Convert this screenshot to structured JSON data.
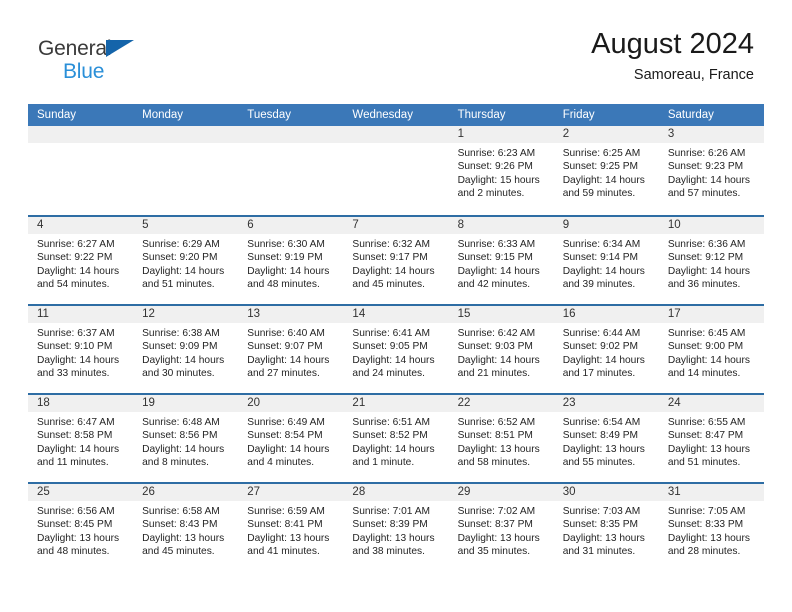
{
  "brand": {
    "name_top": "General",
    "name_bottom": "Blue",
    "triangle_color": "#1464aa",
    "top_color": "#3a3a3a",
    "bottom_color": "#2a8fd8"
  },
  "header": {
    "title": "August 2024",
    "subtitle": "Samoreau, France"
  },
  "theme": {
    "header_bg": "#3b78b8",
    "row_border": "#2e6da4",
    "day_band_bg": "#f0f0f0",
    "text": "#242424"
  },
  "weekdays": [
    "Sunday",
    "Monday",
    "Tuesday",
    "Wednesday",
    "Thursday",
    "Friday",
    "Saturday"
  ],
  "weeks": [
    [
      {
        "day": "",
        "sunrise": "",
        "sunset": "",
        "daylight": "",
        "empty": true
      },
      {
        "day": "",
        "sunrise": "",
        "sunset": "",
        "daylight": "",
        "empty": true
      },
      {
        "day": "",
        "sunrise": "",
        "sunset": "",
        "daylight": "",
        "empty": true
      },
      {
        "day": "",
        "sunrise": "",
        "sunset": "",
        "daylight": "",
        "empty": true
      },
      {
        "day": "1",
        "sunrise": "Sunrise: 6:23 AM",
        "sunset": "Sunset: 9:26 PM",
        "daylight": "Daylight: 15 hours and 2 minutes."
      },
      {
        "day": "2",
        "sunrise": "Sunrise: 6:25 AM",
        "sunset": "Sunset: 9:25 PM",
        "daylight": "Daylight: 14 hours and 59 minutes."
      },
      {
        "day": "3",
        "sunrise": "Sunrise: 6:26 AM",
        "sunset": "Sunset: 9:23 PM",
        "daylight": "Daylight: 14 hours and 57 minutes."
      }
    ],
    [
      {
        "day": "4",
        "sunrise": "Sunrise: 6:27 AM",
        "sunset": "Sunset: 9:22 PM",
        "daylight": "Daylight: 14 hours and 54 minutes."
      },
      {
        "day": "5",
        "sunrise": "Sunrise: 6:29 AM",
        "sunset": "Sunset: 9:20 PM",
        "daylight": "Daylight: 14 hours and 51 minutes."
      },
      {
        "day": "6",
        "sunrise": "Sunrise: 6:30 AM",
        "sunset": "Sunset: 9:19 PM",
        "daylight": "Daylight: 14 hours and 48 minutes."
      },
      {
        "day": "7",
        "sunrise": "Sunrise: 6:32 AM",
        "sunset": "Sunset: 9:17 PM",
        "daylight": "Daylight: 14 hours and 45 minutes."
      },
      {
        "day": "8",
        "sunrise": "Sunrise: 6:33 AM",
        "sunset": "Sunset: 9:15 PM",
        "daylight": "Daylight: 14 hours and 42 minutes."
      },
      {
        "day": "9",
        "sunrise": "Sunrise: 6:34 AM",
        "sunset": "Sunset: 9:14 PM",
        "daylight": "Daylight: 14 hours and 39 minutes."
      },
      {
        "day": "10",
        "sunrise": "Sunrise: 6:36 AM",
        "sunset": "Sunset: 9:12 PM",
        "daylight": "Daylight: 14 hours and 36 minutes."
      }
    ],
    [
      {
        "day": "11",
        "sunrise": "Sunrise: 6:37 AM",
        "sunset": "Sunset: 9:10 PM",
        "daylight": "Daylight: 14 hours and 33 minutes."
      },
      {
        "day": "12",
        "sunrise": "Sunrise: 6:38 AM",
        "sunset": "Sunset: 9:09 PM",
        "daylight": "Daylight: 14 hours and 30 minutes."
      },
      {
        "day": "13",
        "sunrise": "Sunrise: 6:40 AM",
        "sunset": "Sunset: 9:07 PM",
        "daylight": "Daylight: 14 hours and 27 minutes."
      },
      {
        "day": "14",
        "sunrise": "Sunrise: 6:41 AM",
        "sunset": "Sunset: 9:05 PM",
        "daylight": "Daylight: 14 hours and 24 minutes."
      },
      {
        "day": "15",
        "sunrise": "Sunrise: 6:42 AM",
        "sunset": "Sunset: 9:03 PM",
        "daylight": "Daylight: 14 hours and 21 minutes."
      },
      {
        "day": "16",
        "sunrise": "Sunrise: 6:44 AM",
        "sunset": "Sunset: 9:02 PM",
        "daylight": "Daylight: 14 hours and 17 minutes."
      },
      {
        "day": "17",
        "sunrise": "Sunrise: 6:45 AM",
        "sunset": "Sunset: 9:00 PM",
        "daylight": "Daylight: 14 hours and 14 minutes."
      }
    ],
    [
      {
        "day": "18",
        "sunrise": "Sunrise: 6:47 AM",
        "sunset": "Sunset: 8:58 PM",
        "daylight": "Daylight: 14 hours and 11 minutes."
      },
      {
        "day": "19",
        "sunrise": "Sunrise: 6:48 AM",
        "sunset": "Sunset: 8:56 PM",
        "daylight": "Daylight: 14 hours and 8 minutes."
      },
      {
        "day": "20",
        "sunrise": "Sunrise: 6:49 AM",
        "sunset": "Sunset: 8:54 PM",
        "daylight": "Daylight: 14 hours and 4 minutes."
      },
      {
        "day": "21",
        "sunrise": "Sunrise: 6:51 AM",
        "sunset": "Sunset: 8:52 PM",
        "daylight": "Daylight: 14 hours and 1 minute."
      },
      {
        "day": "22",
        "sunrise": "Sunrise: 6:52 AM",
        "sunset": "Sunset: 8:51 PM",
        "daylight": "Daylight: 13 hours and 58 minutes."
      },
      {
        "day": "23",
        "sunrise": "Sunrise: 6:54 AM",
        "sunset": "Sunset: 8:49 PM",
        "daylight": "Daylight: 13 hours and 55 minutes."
      },
      {
        "day": "24",
        "sunrise": "Sunrise: 6:55 AM",
        "sunset": "Sunset: 8:47 PM",
        "daylight": "Daylight: 13 hours and 51 minutes."
      }
    ],
    [
      {
        "day": "25",
        "sunrise": "Sunrise: 6:56 AM",
        "sunset": "Sunset: 8:45 PM",
        "daylight": "Daylight: 13 hours and 48 minutes."
      },
      {
        "day": "26",
        "sunrise": "Sunrise: 6:58 AM",
        "sunset": "Sunset: 8:43 PM",
        "daylight": "Daylight: 13 hours and 45 minutes."
      },
      {
        "day": "27",
        "sunrise": "Sunrise: 6:59 AM",
        "sunset": "Sunset: 8:41 PM",
        "daylight": "Daylight: 13 hours and 41 minutes."
      },
      {
        "day": "28",
        "sunrise": "Sunrise: 7:01 AM",
        "sunset": "Sunset: 8:39 PM",
        "daylight": "Daylight: 13 hours and 38 minutes."
      },
      {
        "day": "29",
        "sunrise": "Sunrise: 7:02 AM",
        "sunset": "Sunset: 8:37 PM",
        "daylight": "Daylight: 13 hours and 35 minutes."
      },
      {
        "day": "30",
        "sunrise": "Sunrise: 7:03 AM",
        "sunset": "Sunset: 8:35 PM",
        "daylight": "Daylight: 13 hours and 31 minutes."
      },
      {
        "day": "31",
        "sunrise": "Sunrise: 7:05 AM",
        "sunset": "Sunset: 8:33 PM",
        "daylight": "Daylight: 13 hours and 28 minutes."
      }
    ]
  ]
}
